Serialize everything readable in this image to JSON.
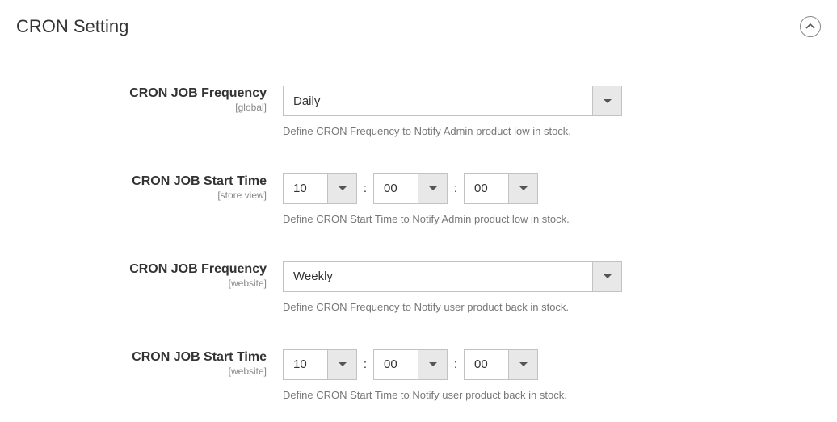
{
  "section": {
    "title": "CRON Setting"
  },
  "fields": {
    "cron_freq_admin": {
      "label": "CRON JOB Frequency",
      "scope": "[global]",
      "value": "Daily",
      "help": "Define CRON Frequency to Notify Admin product low in stock."
    },
    "cron_start_admin": {
      "label": "CRON JOB Start Time",
      "scope": "[store view]",
      "hh": "10",
      "mm": "00",
      "ss": "00",
      "sep": ":",
      "help": "Define CRON Start Time to Notify Admin product low in stock."
    },
    "cron_freq_user": {
      "label": "CRON JOB Frequency",
      "scope": "[website]",
      "value": "Weekly",
      "help": "Define CRON Frequency to Notify user product back in stock."
    },
    "cron_start_user": {
      "label": "CRON JOB Start Time",
      "scope": "[website]",
      "hh": "10",
      "mm": "00",
      "ss": "00",
      "sep": ":",
      "help": "Define CRON Start Time to Notify user product back in stock."
    }
  }
}
